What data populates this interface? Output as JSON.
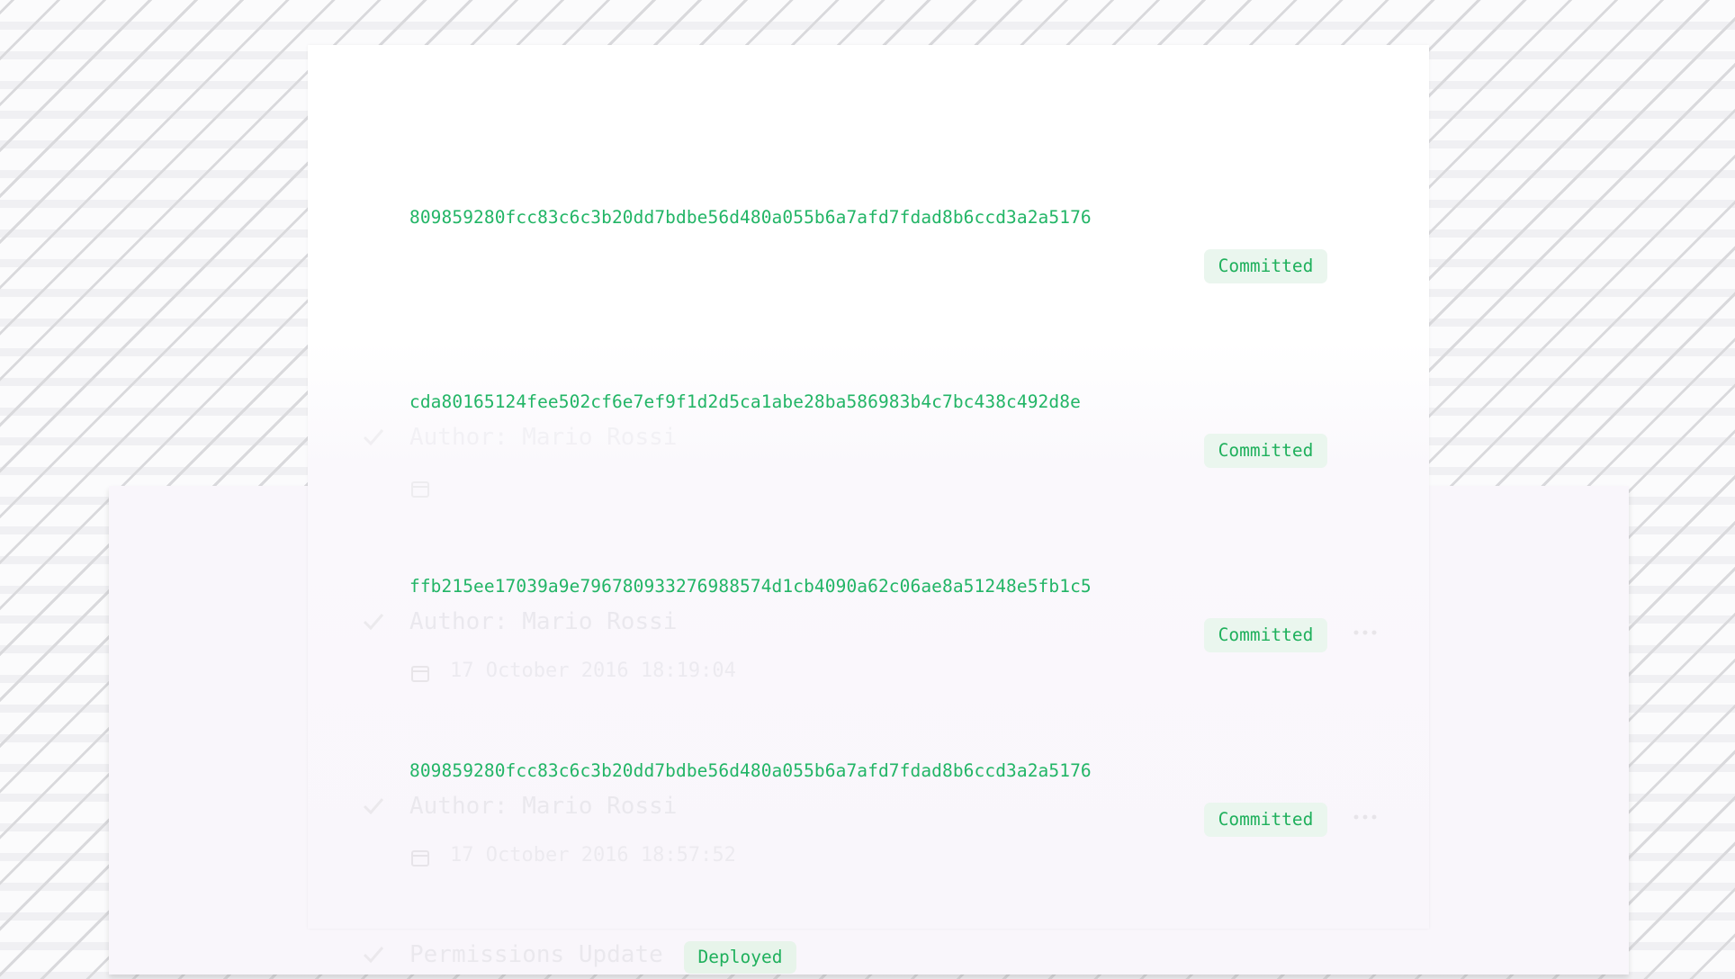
{
  "commits": [
    {
      "hash": "809859280fcc83c6c3b20dd7bdbe56d480a055b6a7afd7fdad8b6ccd3a2a5176",
      "author": "",
      "date": "",
      "status": "Committed"
    },
    {
      "hash": "cda80165124fee502cf6e7ef9f1d2d5ca1abe28ba586983b4c7bc438c492d8e",
      "author": "Author: Mario Rossi",
      "date": "",
      "status": "Committed"
    },
    {
      "hash": "ffb215ee17039a9e796780933276988574d1cb4090a62c06ae8a51248e5fb1c5",
      "author": "Author: Mario Rossi",
      "date": "17 October 2016 18:19:04",
      "status": "Committed"
    },
    {
      "hash": "809859280fcc83c6c3b20dd7bdbe56d480a055b6a7afd7fdad8b6ccd3a2a5176",
      "author": "Author: Mario Rossi",
      "date": "17 October 2016 18:57:52",
      "status": "Committed"
    }
  ],
  "bottom_item": {
    "title": "Permissions Update",
    "status": "Deployed"
  },
  "icons": {
    "check": "check-icon",
    "calendar": "calendar-icon",
    "more": "more-horizontal-icon"
  },
  "colors": {
    "accent_green": "#22b566",
    "badge_background": "#eaf6ee"
  }
}
